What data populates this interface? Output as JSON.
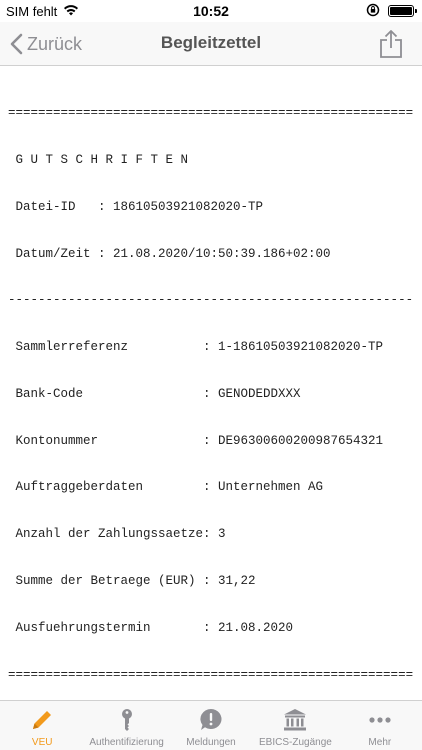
{
  "status": {
    "carrier": "SIM fehlt",
    "time": "10:52"
  },
  "nav": {
    "back_label": "Zurück",
    "title": "Begleitzettel"
  },
  "slip": {
    "lines": [
      "======================================================",
      " G U T S C H R I F T E N",
      " Datei-ID   : 18610503921082020-TP",
      " Datum/Zeit : 21.08.2020/10:50:39.186+02:00",
      "------------------------------------------------------",
      " Sammlerreferenz          : 1-18610503921082020-TP",
      " Bank-Code                : GENODEDDXXX",
      " Kontonummer              : DE96300600200987654321",
      " Auftraggeberdaten        : Unternehmen AG",
      " Anzahl der Zahlungssaetze: 3",
      " Summe der Betraege (EUR) : 31,22",
      " Ausfuehrungstermin       : 21.08.2020",
      "======================================================"
    ]
  },
  "tabs": [
    {
      "label": "VEU",
      "icon": "pencil-icon",
      "active": true
    },
    {
      "label": "Authentifizierung",
      "icon": "key-icon",
      "active": false
    },
    {
      "label": "Meldungen",
      "icon": "alert-bubble-icon",
      "active": false
    },
    {
      "label": "EBICS-Zugänge",
      "icon": "bank-icon",
      "active": false
    },
    {
      "label": "Mehr",
      "icon": "more-icon",
      "active": false
    }
  ],
  "colors": {
    "accent": "#f29a1c",
    "inactive": "#8e8e93"
  }
}
